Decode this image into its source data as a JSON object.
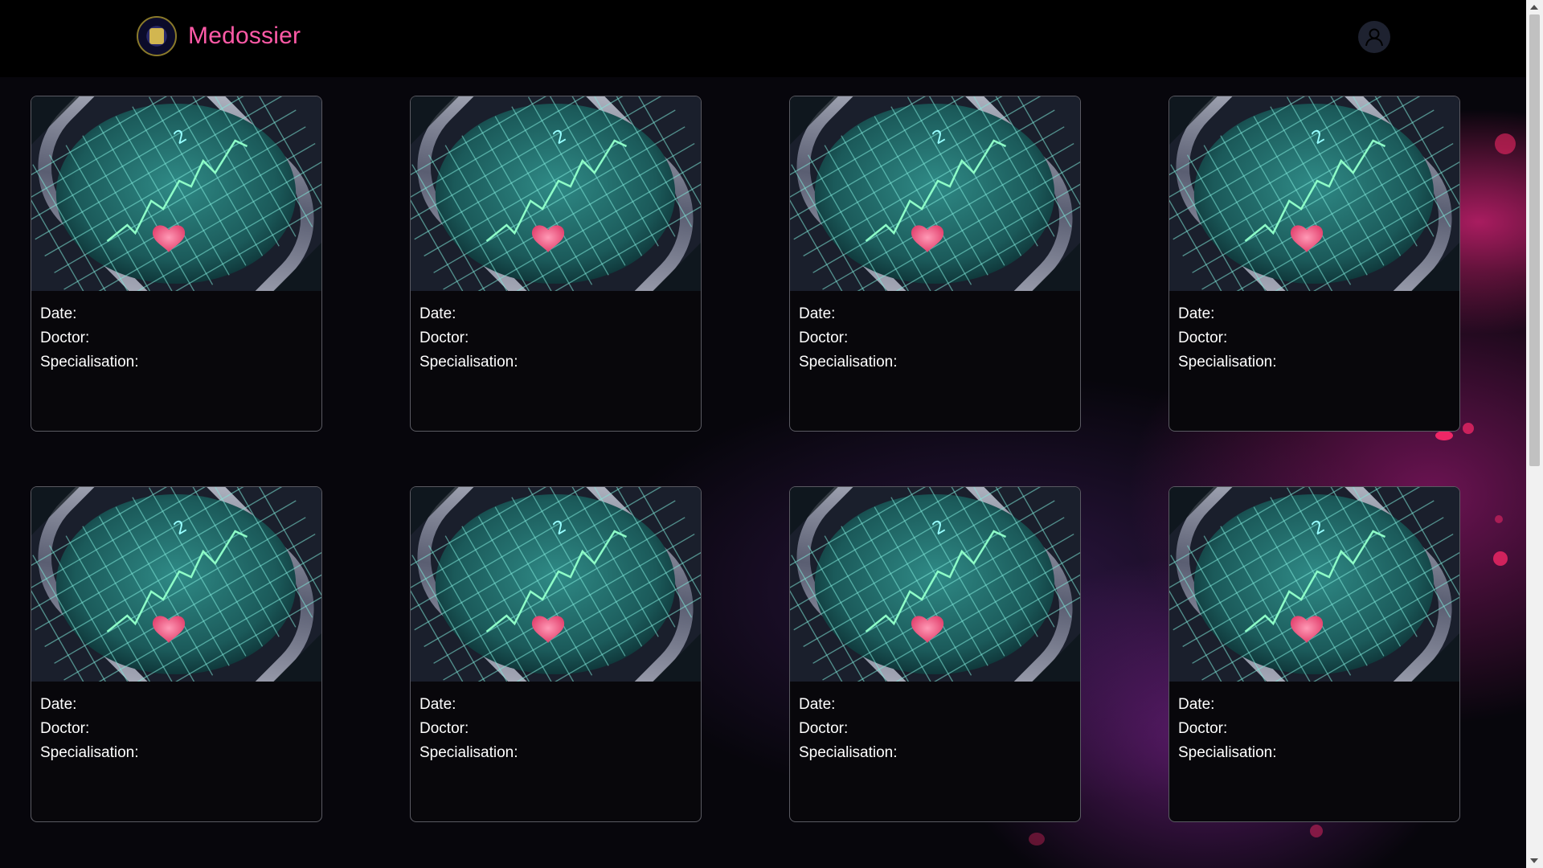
{
  "navbar": {
    "brand_name": "Medossier",
    "logo_icon": "medossier-logo",
    "profile_icon": "user-icon"
  },
  "colors": {
    "brand": "#ff5aa7",
    "navbar_bg": "#000000",
    "card_bg": "#08070b",
    "text": "#ffffff"
  },
  "cards": [
    {
      "date_label": "Date:",
      "doctor_label": "Doctor:",
      "specialisation_label": "Specialisation:",
      "image": "heart-monitor-image"
    },
    {
      "date_label": "Date:",
      "doctor_label": "Doctor:",
      "specialisation_label": "Specialisation:",
      "image": "heart-monitor-image"
    },
    {
      "date_label": "Date:",
      "doctor_label": "Doctor:",
      "specialisation_label": "Specialisation:",
      "image": "heart-monitor-image"
    },
    {
      "date_label": "Date:",
      "doctor_label": "Doctor:",
      "specialisation_label": "Specialisation:",
      "image": "heart-monitor-image"
    },
    {
      "date_label": "Date:",
      "doctor_label": "Doctor:",
      "specialisation_label": "Specialisation:",
      "image": "heart-monitor-image"
    },
    {
      "date_label": "Date:",
      "doctor_label": "Doctor:",
      "specialisation_label": "Specialisation:",
      "image": "heart-monitor-image"
    },
    {
      "date_label": "Date:",
      "doctor_label": "Doctor:",
      "specialisation_label": "Specialisation:",
      "image": "heart-monitor-image"
    },
    {
      "date_label": "Date:",
      "doctor_label": "Doctor:",
      "specialisation_label": "Specialisation:",
      "image": "heart-monitor-image"
    }
  ]
}
